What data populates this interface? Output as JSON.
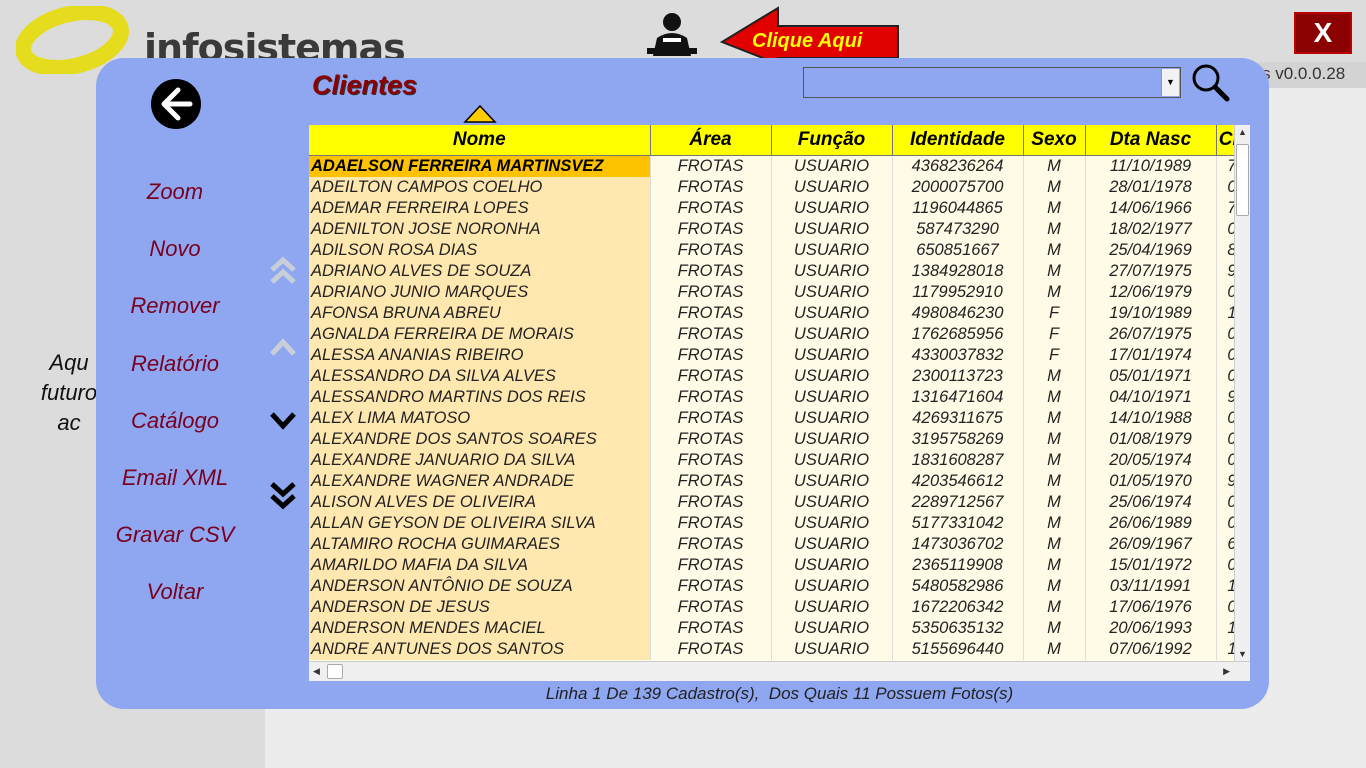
{
  "app": {
    "logo_text": "infosistemas",
    "clique_label": "Clique Aqui",
    "close_label": "X",
    "version": "s v0.0.0.28",
    "bg_text_lines": [
      "Aqu",
      "futuro",
      "ac"
    ]
  },
  "dialog": {
    "title": "Clientes",
    "menu": [
      "Zoom",
      "Novo",
      "Remover",
      "Relatório",
      "Catálogo",
      "Email XML",
      "Gravar CSV",
      "Voltar"
    ],
    "search_value": "",
    "status_text": "Linha 1 De 139 Cadastro(s),  Dos Quais 11 Possuem Fotos(s)"
  },
  "grid": {
    "columns": [
      "Nome",
      "Área",
      "Função",
      "Identidade",
      "Sexo",
      "Dta Nasc",
      "CP"
    ],
    "rows": [
      [
        "ADAELSON FERREIRA MARTINSVEZ",
        "FROTAS",
        "USUARIO",
        "4368236264",
        "M",
        "11/10/1989",
        "7"
      ],
      [
        "ADEILTON CAMPOS COELHO",
        "FROTAS",
        "USUARIO",
        "2000075700",
        "M",
        "28/01/1978",
        "0"
      ],
      [
        "ADEMAR FERREIRA LOPES",
        "FROTAS",
        "USUARIO",
        "1196044865",
        "M",
        "14/06/1966",
        "7"
      ],
      [
        "ADENILTON JOSE NORONHA",
        "FROTAS",
        "USUARIO",
        "587473290",
        "M",
        "18/02/1977",
        "0"
      ],
      [
        "ADILSON ROSA DIAS",
        "FROTAS",
        "USUARIO",
        "650851667",
        "M",
        "25/04/1969",
        "8"
      ],
      [
        "ADRIANO ALVES DE SOUZA",
        "FROTAS",
        "USUARIO",
        "1384928018",
        "M",
        "27/07/1975",
        "9"
      ],
      [
        "ADRIANO JUNIO MARQUES",
        "FROTAS",
        "USUARIO",
        "1179952910",
        "M",
        "12/06/1979",
        "0"
      ],
      [
        "AFONSA BRUNA ABREU",
        "FROTAS",
        "USUARIO",
        "4980846230",
        "F",
        "19/10/1989",
        "1"
      ],
      [
        "AGNALDA FERREIRA DE MORAIS",
        "FROTAS",
        "USUARIO",
        "1762685956",
        "F",
        "26/07/1975",
        "0"
      ],
      [
        "ALESSA ANANIAS RIBEIRO",
        "FROTAS",
        "USUARIO",
        "4330037832",
        "F",
        "17/01/1974",
        "0"
      ],
      [
        "ALESSANDRO DA SILVA ALVES",
        "FROTAS",
        "USUARIO",
        "2300113723",
        "M",
        "05/01/1971",
        "0"
      ],
      [
        "ALESSANDRO MARTINS DOS REIS",
        "FROTAS",
        "USUARIO",
        "1316471604",
        "M",
        "04/10/1971",
        "9"
      ],
      [
        "ALEX LIMA MATOSO",
        "FROTAS",
        "USUARIO",
        "4269311675",
        "M",
        "14/10/1988",
        "0"
      ],
      [
        "ALEXANDRE DOS SANTOS SOARES",
        "FROTAS",
        "USUARIO",
        "3195758269",
        "M",
        "01/08/1979",
        "0"
      ],
      [
        "ALEXANDRE JANUARIO DA SILVA",
        "FROTAS",
        "USUARIO",
        "1831608287",
        "M",
        "20/05/1974",
        "0"
      ],
      [
        "ALEXANDRE WAGNER ANDRADE",
        "FROTAS",
        "USUARIO",
        "4203546612",
        "M",
        "01/05/1970",
        "9"
      ],
      [
        "ALISON ALVES DE OLIVEIRA",
        "FROTAS",
        "USUARIO",
        "2289712567",
        "M",
        "25/06/1974",
        "0"
      ],
      [
        "ALLAN GEYSON DE OLIVEIRA SILVA",
        "FROTAS",
        "USUARIO",
        "5177331042",
        "M",
        "26/06/1989",
        "0"
      ],
      [
        "ALTAMIRO ROCHA GUIMARAES",
        "FROTAS",
        "USUARIO",
        "1473036702",
        "M",
        "26/09/1967",
        "6"
      ],
      [
        "AMARILDO MAFIA DA SILVA",
        "FROTAS",
        "USUARIO",
        "2365119908",
        "M",
        "15/01/1972",
        "0"
      ],
      [
        "ANDERSON ANTÔNIO DE SOUZA",
        "FROTAS",
        "USUARIO",
        "5480582986",
        "M",
        "03/11/1991",
        "1"
      ],
      [
        "ANDERSON DE JESUS",
        "FROTAS",
        "USUARIO",
        "1672206342",
        "M",
        "17/06/1976",
        "0"
      ],
      [
        "ANDERSON MENDES MACIEL",
        "FROTAS",
        "USUARIO",
        "5350635132",
        "M",
        "20/06/1993",
        "1"
      ],
      [
        "ANDRE ANTUNES DOS SANTOS",
        "FROTAS",
        "USUARIO",
        "5155696440",
        "M",
        "07/06/1992",
        "1"
      ]
    ]
  },
  "colors": {
    "panel": "#8ea7f0",
    "header": "#ffff00",
    "name_cell": "#ffe7b0",
    "selected": "#ffc200",
    "accent": "#8b0000"
  },
  "icons": [
    "back-arrow-icon",
    "support-person-icon",
    "search-icon",
    "double-up-icon",
    "up-icon",
    "down-icon",
    "double-down-icon",
    "sort-ascending-icon"
  ]
}
